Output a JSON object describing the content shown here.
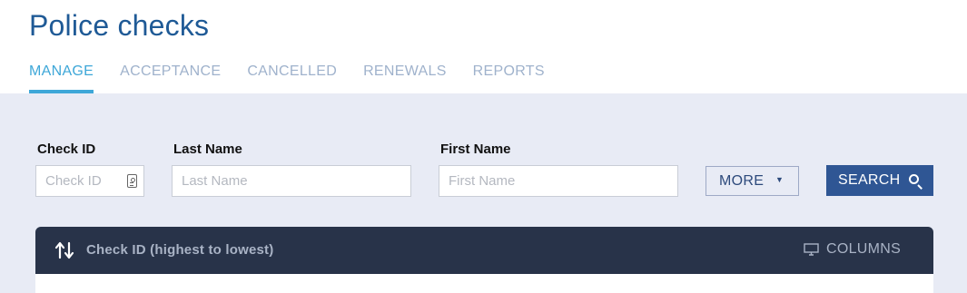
{
  "header": {
    "title": "Police checks",
    "tabs": [
      "MANAGE",
      "ACCEPTANCE",
      "CANCELLED",
      "RENEWALS",
      "REPORTS"
    ],
    "active_tab": "MANAGE"
  },
  "filters": {
    "check_id": {
      "label": "Check ID",
      "placeholder": "Check ID",
      "value": ""
    },
    "last_name": {
      "label": "Last Name",
      "placeholder": "Last Name",
      "value": ""
    },
    "first_name": {
      "label": "First Name",
      "placeholder": "First Name",
      "value": ""
    },
    "more_label": "MORE",
    "search_label": "SEARCH"
  },
  "results": {
    "sort_label": "Check ID (highest to lowest)",
    "columns_label": "COLUMNS"
  },
  "icons": {
    "id_card": "id-card-icon",
    "dropdown": "caret-down-icon",
    "search": "search-icon",
    "sort": "sort-icon",
    "columns": "monitor-icon"
  },
  "colors": {
    "title": "#1f5a96",
    "active_tab": "#3ea7d8",
    "inactive_tab": "#9fb2cc",
    "panel_bg": "#e8ebf5",
    "primary_button": "#2f5694",
    "results_bar": "#283349"
  }
}
